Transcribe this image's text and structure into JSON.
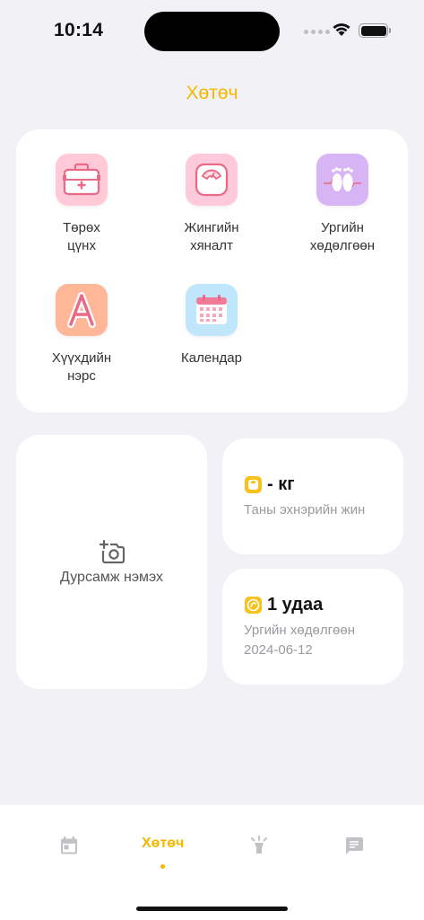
{
  "status": {
    "time": "10:14"
  },
  "header": {
    "title": "Хөтөч"
  },
  "tools": [
    {
      "label": "Төрөх\nцүнх",
      "icon": "medical-bag-icon",
      "bg": "#ffc9d8"
    },
    {
      "label": "Жингийн\nхяналт",
      "icon": "scale-icon",
      "bg": "#ffc9dc"
    },
    {
      "label": "Ургийн\nхөдөлгөөн",
      "icon": "baby-feet-icon",
      "bg": "#d7b5f5"
    },
    {
      "label": "Хүүхдийн\nнэрс",
      "icon": "letter-a-icon",
      "bg": "#ffb797"
    },
    {
      "label": "Календар",
      "icon": "calendar-grid-icon",
      "bg": "#bfe6fb"
    }
  ],
  "memory": {
    "label": "Дурсамж нэмэх",
    "icon": "add-photo-icon"
  },
  "weight": {
    "value": "- кг",
    "label": "Таны эхнэрийн жин",
    "icon": "scale-mini-icon"
  },
  "movement": {
    "value": "1 удаа",
    "label": "Ургийн хөдөлгөөн",
    "date": "2024-06-12",
    "icon": "movement-mini-icon"
  },
  "tabbar": {
    "tabs": [
      {
        "name": "calendar",
        "icon": "calendar-icon"
      },
      {
        "name": "guide",
        "label": "Хөтөч",
        "active": true
      },
      {
        "name": "tips",
        "icon": "lightbulb-icon"
      },
      {
        "name": "chat",
        "icon": "chat-icon"
      }
    ]
  },
  "colors": {
    "accent": "#f5b800",
    "background": "#f2f2f6",
    "card": "#ffffff"
  }
}
